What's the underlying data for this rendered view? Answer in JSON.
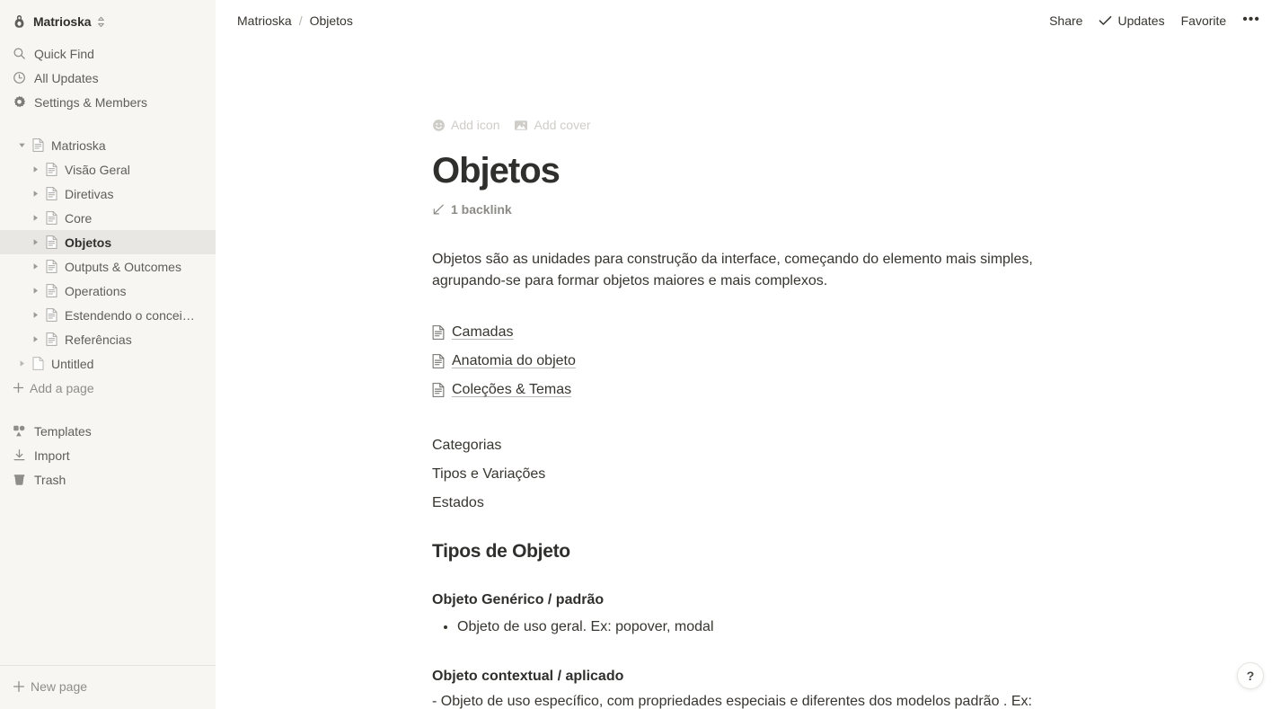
{
  "workspace": {
    "name": "Matrioska",
    "icon": "matryoshka-doll-icon",
    "switcher_icon": "chevron-up-down-icon"
  },
  "sidebar": {
    "nav": [
      {
        "label": "Quick Find",
        "icon": "search-icon"
      },
      {
        "label": "All Updates",
        "icon": "clock-icon"
      },
      {
        "label": "Settings & Members",
        "icon": "gear-icon"
      }
    ],
    "tree": [
      {
        "label": "Matrioska",
        "depth": 0,
        "expanded": true,
        "selected": false,
        "icon": "page-lines-icon"
      },
      {
        "label": "Visão Geral",
        "depth": 1,
        "expanded": false,
        "selected": false,
        "icon": "page-lines-icon"
      },
      {
        "label": "Diretivas",
        "depth": 1,
        "expanded": false,
        "selected": false,
        "icon": "page-lines-icon"
      },
      {
        "label": "Core",
        "depth": 1,
        "expanded": false,
        "selected": false,
        "icon": "page-lines-icon"
      },
      {
        "label": "Objetos",
        "depth": 1,
        "expanded": false,
        "selected": true,
        "icon": "page-lines-icon"
      },
      {
        "label": "Outputs & Outcomes",
        "depth": 1,
        "expanded": false,
        "selected": false,
        "icon": "page-lines-icon"
      },
      {
        "label": "Operations",
        "depth": 1,
        "expanded": false,
        "selected": false,
        "icon": "page-lines-icon"
      },
      {
        "label": "Estendendo o concei…",
        "depth": 1,
        "expanded": false,
        "selected": false,
        "icon": "page-lines-icon"
      },
      {
        "label": "Referências",
        "depth": 1,
        "expanded": false,
        "selected": false,
        "icon": "page-lines-icon"
      },
      {
        "label": "Untitled",
        "depth": 0,
        "expanded": false,
        "selected": false,
        "icon": "page-blank-icon"
      }
    ],
    "add_a_page": {
      "label": "Add a page",
      "icon": "plus-icon"
    },
    "tools": [
      {
        "label": "Templates",
        "icon": "templates-icon"
      },
      {
        "label": "Import",
        "icon": "import-download-icon"
      },
      {
        "label": "Trash",
        "icon": "trash-icon"
      }
    ],
    "new_page": {
      "label": "New page",
      "icon": "plus-icon"
    }
  },
  "topbar": {
    "breadcrumb": [
      "Matrioska",
      "Objetos"
    ],
    "separator": "/",
    "share_label": "Share",
    "updates_label": "Updates",
    "updates_icon": "check-icon",
    "favorite_label": "Favorite",
    "more_label": "•••"
  },
  "page": {
    "add_icon_label": "Add icon",
    "add_icon_glyph": "smiley-icon",
    "add_cover_label": "Add cover",
    "add_cover_glyph": "image-icon",
    "title": "Objetos",
    "backlink_label": "1 backlink",
    "backlink_icon": "arrow-down-left-icon",
    "intro": "Objetos são as unidades para construção da interface, começando do elemento mais simples, agrupando-se para formar objetos maiores e mais complexos.",
    "page_links": [
      {
        "label": "Camadas",
        "icon": "page-lines-icon"
      },
      {
        "label": "Anatomia do objeto",
        "icon": "page-lines-icon"
      },
      {
        "label": "Coleções & Temas",
        "icon": "page-lines-icon"
      }
    ],
    "plain_lines": [
      "Categorias",
      "Tipos e Variações",
      "Estados"
    ],
    "section_heading": "Tipos de Objeto",
    "sub1_heading": "Objeto Genérico / padrão",
    "sub1_bullets": [
      "Objeto de uso geral. Ex: popover, modal"
    ],
    "sub2_heading": "Objeto contextual / aplicado",
    "sub2_line": "- Objeto de uso específico, com propriedades especiais e diferentes dos modelos padrão . Ex:"
  },
  "help": {
    "label": "?"
  },
  "colors": {
    "sidebar_bg": "#f7f6f3",
    "selected_row": "#e8e7e4",
    "text": "#37352f",
    "muted": "#8e8d89",
    "placeholder": "#cfcdc8"
  }
}
